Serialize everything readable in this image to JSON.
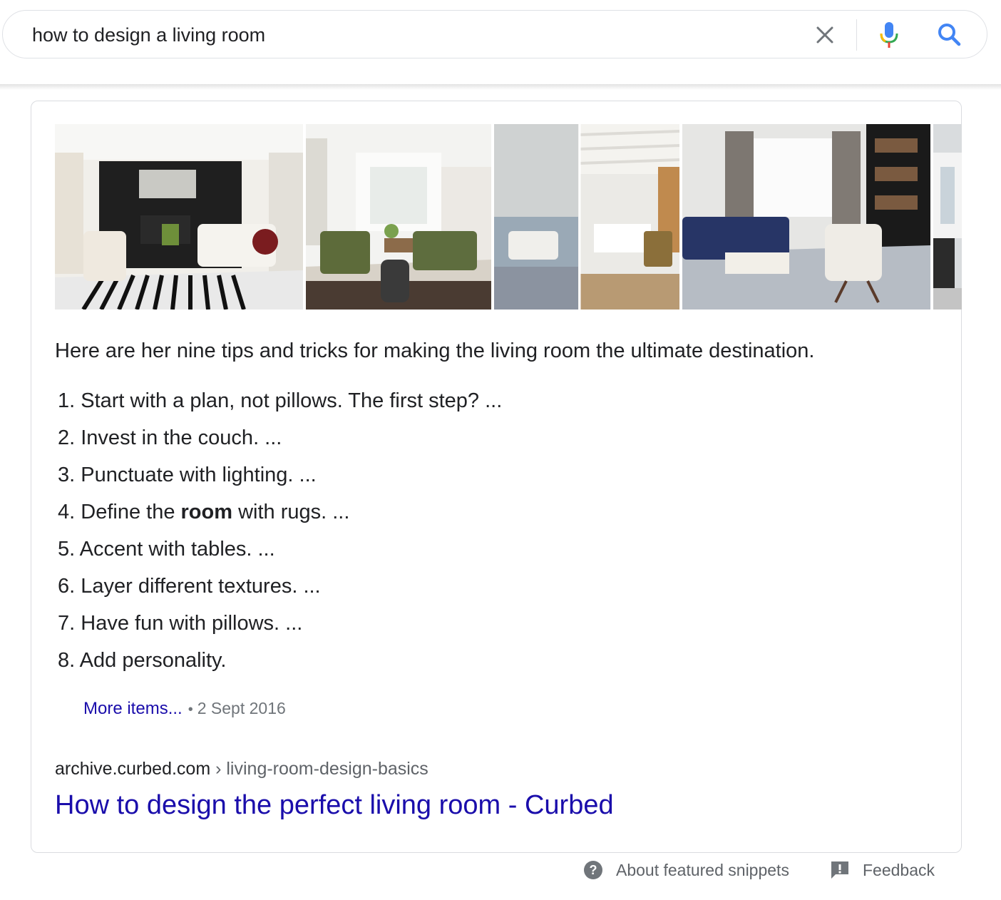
{
  "search": {
    "query": "how to design a living room"
  },
  "snippet": {
    "intro": "Here are her nine tips and tricks for making the living room the ultimate destination.",
    "tips": [
      {
        "num": "1.",
        "text": "Start with a plan, not pillows. The first step? ..."
      },
      {
        "num": "2.",
        "text": "Invest in the couch. ..."
      },
      {
        "num": "3.",
        "text": "Punctuate with lighting. ..."
      },
      {
        "num": "4.",
        "before": "Define the ",
        "bold": "room",
        "after": " with rugs. ..."
      },
      {
        "num": "5.",
        "text": "Accent with tables. ..."
      },
      {
        "num": "6.",
        "text": "Layer different textures. ..."
      },
      {
        "num": "7.",
        "text": "Have fun with pillows. ..."
      },
      {
        "num": "8.",
        "text": "Add personality."
      }
    ],
    "more_items": "More items...",
    "separator": "•",
    "date": "2 Sept 2016",
    "domain": "archive.curbed.com",
    "path": " › living-room-design-basics",
    "title": "How to design the perfect living room - Curbed"
  },
  "footer": {
    "about": "About featured snippets",
    "feedback": "Feedback"
  },
  "colors": {
    "link": "#1a0dab",
    "text": "#202124",
    "muted": "#70757a",
    "mic_blue": "#4285f4",
    "mic_red": "#ea4335",
    "search_icon": "#4285f4"
  }
}
